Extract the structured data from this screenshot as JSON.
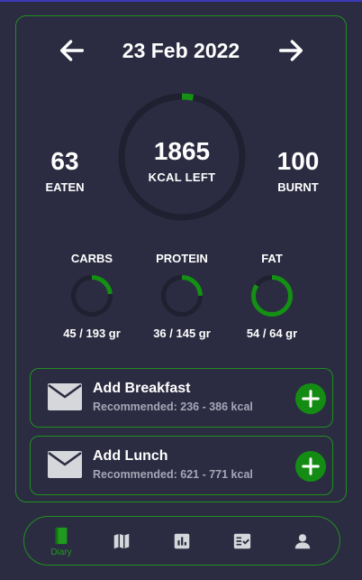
{
  "header": {
    "date": "23 Feb 2022",
    "prev_icon": "arrow-left-icon",
    "next_icon": "arrow-right-icon"
  },
  "summary": {
    "eaten_value": "63",
    "eaten_label": "EATEN",
    "kcal_left_value": "1865",
    "kcal_left_label": "KCAL LEFT",
    "kcal_progress": 0.03,
    "burnt_value": "100",
    "burnt_label": "BURNT"
  },
  "macros": [
    {
      "label": "CARBS",
      "value": "45 / 193  gr",
      "progress": 0.233
    },
    {
      "label": "PROTEIN",
      "value": "36 / 145  gr",
      "progress": 0.248
    },
    {
      "label": "FAT",
      "value": "54 / 64  gr",
      "progress": 0.844
    }
  ],
  "meals": [
    {
      "title": "Add Breakfast",
      "subtitle": "Recommended: 236 - 386 kcal",
      "icon": "envelope-icon",
      "add_icon": "plus-icon"
    },
    {
      "title": "Add Lunch",
      "subtitle": "Recommended: 621 - 771 kcal",
      "icon": "envelope-icon",
      "add_icon": "plus-icon"
    }
  ],
  "nav": {
    "items": [
      {
        "label": "Diary",
        "icon": "diary-icon",
        "active": true
      },
      {
        "label": "",
        "icon": "map-icon",
        "active": false
      },
      {
        "label": "",
        "icon": "stats-icon",
        "active": false
      },
      {
        "label": "",
        "icon": "checklist-icon",
        "active": false
      },
      {
        "label": "",
        "icon": "profile-icon",
        "active": false
      }
    ]
  },
  "colors": {
    "background": "#2b2c41",
    "accent": "#1f8f1f",
    "progress": "#149014",
    "track": "#1f2030",
    "text": "#ffffff",
    "muted": "#a5a6b6"
  }
}
